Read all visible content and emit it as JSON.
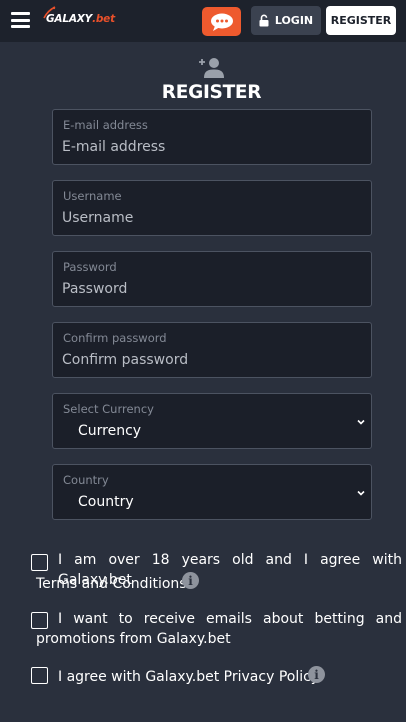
{
  "header": {
    "logo": {
      "part1": "GALAXY",
      "part2": ".bet"
    },
    "menu_icon": "hamburger-icon",
    "chat_icon": "chat-bubble-icon",
    "login_label": "LOGIN",
    "register_label": "REGISTER",
    "colors": {
      "bar": "#1d222c",
      "chat": "#ee5a2e",
      "login": "#3b4250",
      "register": "#ffffff"
    }
  },
  "form": {
    "icon": "add-user-icon",
    "title": "REGISTER",
    "fields": [
      {
        "label": "E-mail address",
        "placeholder": "E-mail address"
      },
      {
        "label": "Username",
        "placeholder": "Username"
      },
      {
        "label": "Password",
        "placeholder": "Password"
      },
      {
        "label": "Confirm password",
        "placeholder": "Confirm password"
      }
    ],
    "selects": [
      {
        "label": "Select Currency",
        "value": "Currency"
      },
      {
        "label": "Country",
        "value": "Country"
      }
    ],
    "checkboxes": [
      {
        "line1": "I am over 18 years old and I agree with Galaxy.bet",
        "line2": "Terms and Conditions",
        "checked": false,
        "info_icon": "info-icon"
      },
      {
        "line1": "I want to receive emails about betting and",
        "line2": "promotions from Galaxy.bet",
        "checked": false
      },
      {
        "line1": "I agree with Galaxy.bet Privacy Policy",
        "checked": false,
        "info_icon": "info-icon"
      }
    ]
  },
  "colors": {
    "background": "#2a303d",
    "field_bg": "#1b1f29",
    "field_border": "#4c5361",
    "accent": "#e8502a"
  }
}
